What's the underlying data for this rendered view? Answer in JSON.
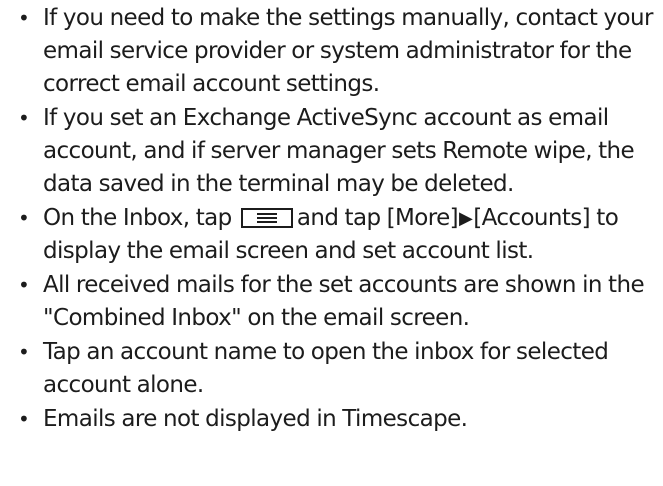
{
  "notes": [
    {
      "text": "If you need to make the settings manually, contact your email service provider or system administrator for the correct email account settings."
    },
    {
      "text": "If you set an Exchange ActiveSync account as email account, and if server manager sets Remote wipe, the data saved in the terminal may be deleted."
    },
    {
      "before": "On the Inbox, tap",
      "middle": "and tap [More]",
      "after": "[Accounts] to display the email screen and set account list.",
      "key_icon": "menu-key-icon",
      "arrow_icon": "right-triangle-icon"
    },
    {
      "text": "All received mails for the set accounts are shown in the \"Combined Inbox\" on the email screen."
    },
    {
      "text": "Tap an account name to open the inbox for selected account alone."
    },
    {
      "text": "Emails are not displayed in Timescape."
    }
  ]
}
